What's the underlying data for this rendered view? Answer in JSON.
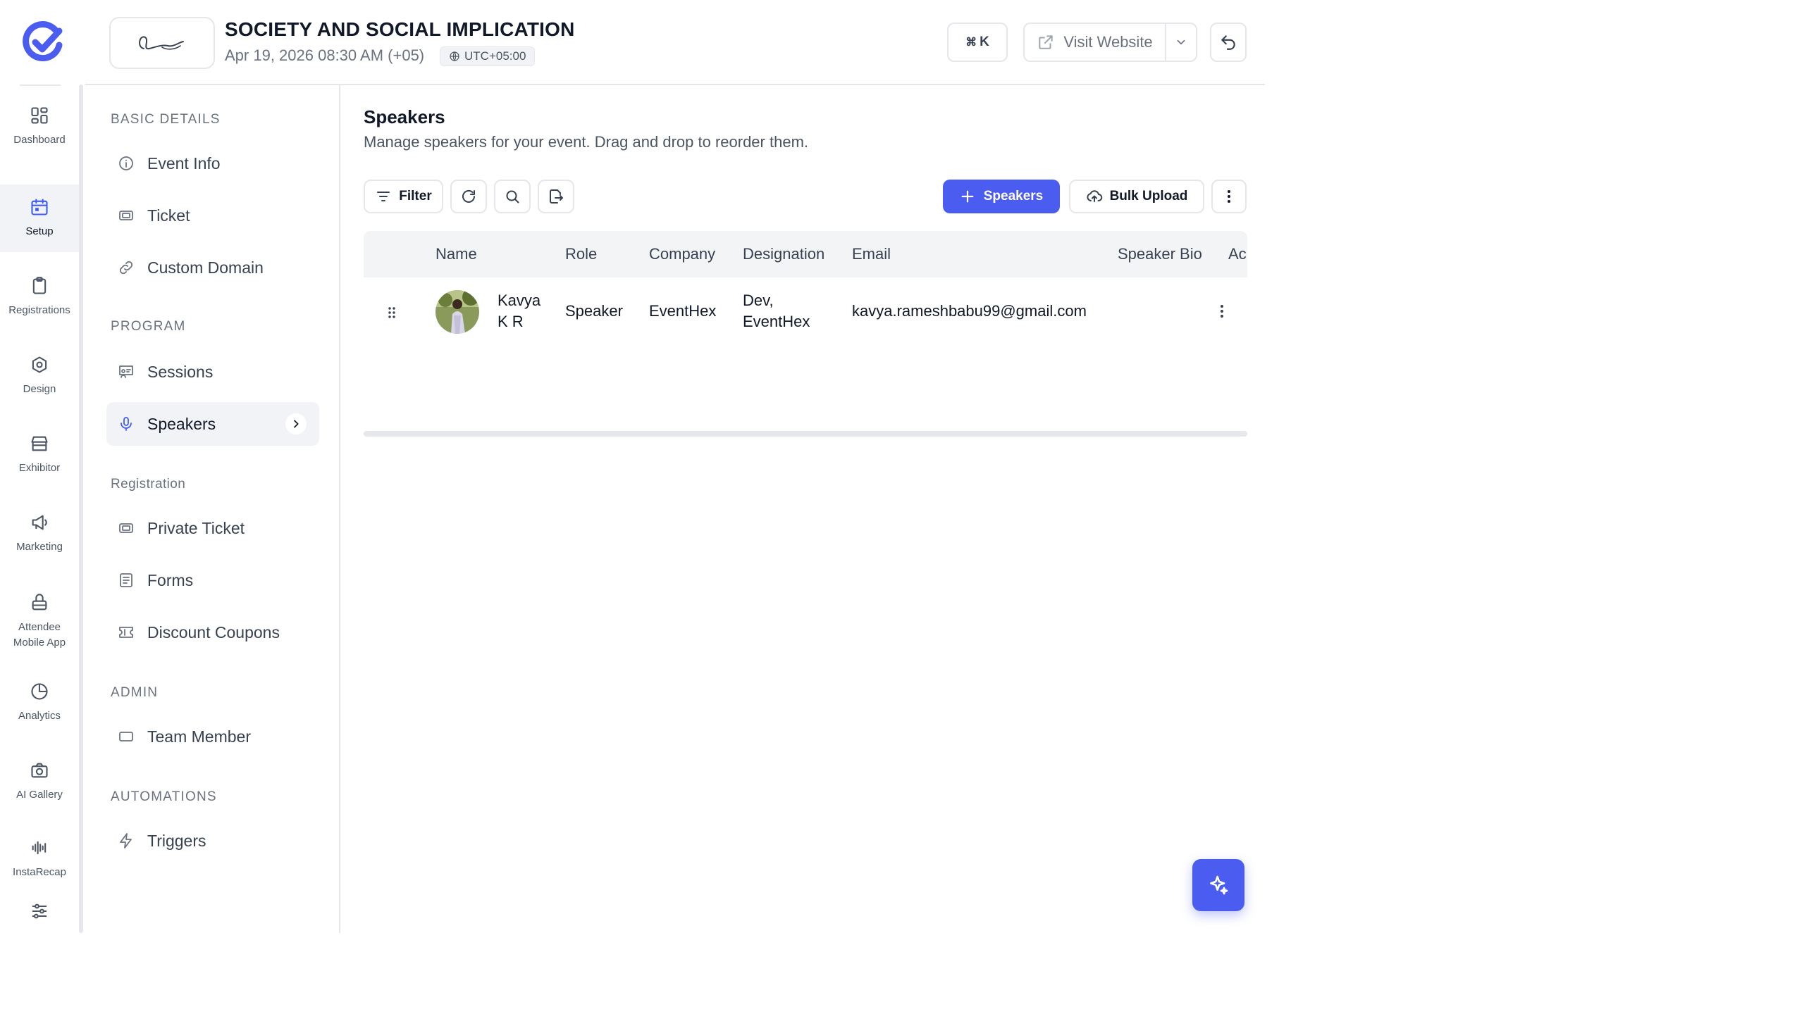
{
  "colors": {
    "accent": "#4b5cf0",
    "active_icon": "#3d5afe",
    "border": "#e5e7eb",
    "muted_bg": "#f1f3f6"
  },
  "rail": {
    "items": [
      {
        "label": "Dashboard",
        "icon": "dashboard-icon",
        "active": false
      },
      {
        "label": "Setup",
        "icon": "calendar-icon",
        "active": true
      },
      {
        "label": "Registrations",
        "icon": "clipboard-icon",
        "active": false
      },
      {
        "label": "Design",
        "icon": "palette-icon",
        "active": false
      },
      {
        "label": "Exhibitor",
        "icon": "storefront-icon",
        "active": false
      },
      {
        "label": "Marketing",
        "icon": "megaphone-icon",
        "active": false
      },
      {
        "label": "Attendee Mobile App",
        "icon": "mobile-app-icon",
        "active": false
      },
      {
        "label": "Analytics",
        "icon": "pie-chart-icon",
        "active": false
      },
      {
        "label": "AI Gallery",
        "icon": "camera-icon",
        "active": false
      },
      {
        "label": "InstaRecap",
        "icon": "audio-wave-icon",
        "active": false
      },
      {
        "label": "",
        "icon": "settings-sliders-icon",
        "active": false
      }
    ]
  },
  "header": {
    "event_title": "SOCIETY AND SOCIAL IMPLICATION",
    "event_date": "Apr 19, 2026 08:30 AM (+05)",
    "timezone": "UTC+05:00",
    "shortcut_symbol": "⌘",
    "shortcut_key": "K",
    "visit_label": "Visit Website"
  },
  "subnav": {
    "sections": {
      "basic": "BASIC DETAILS",
      "program": "PROGRAM",
      "registration": "Registration",
      "admin": "ADMIN",
      "automations": "AUTOMATIONS"
    },
    "items": {
      "event_info": "Event Info",
      "ticket": "Ticket",
      "custom_domain": "Custom Domain",
      "sessions": "Sessions",
      "speakers": "Speakers",
      "private_ticket": "Private Ticket",
      "forms": "Forms",
      "discount_coupons": "Discount Coupons",
      "team_member": "Team Member",
      "triggers": "Triggers"
    }
  },
  "main": {
    "title": "Speakers",
    "subtitle": "Manage speakers for your event. Drag and drop to reorder them.",
    "toolbar": {
      "filter_label": "Filter",
      "add_label": "Speakers",
      "bulk_label": "Bulk Upload"
    },
    "table": {
      "columns": [
        "Name",
        "Role",
        "Company",
        "Designation",
        "Email",
        "Speaker Bio",
        "Ac"
      ],
      "rows": [
        {
          "name_line1": "Kavya",
          "name_line2": "K R",
          "role": "Speaker",
          "company": "EventHex",
          "designation_line1": "Dev,",
          "designation_line2": "EventHex",
          "email": "kavya.rameshbabu99@gmail.com",
          "speaker_bio": ""
        }
      ]
    }
  }
}
